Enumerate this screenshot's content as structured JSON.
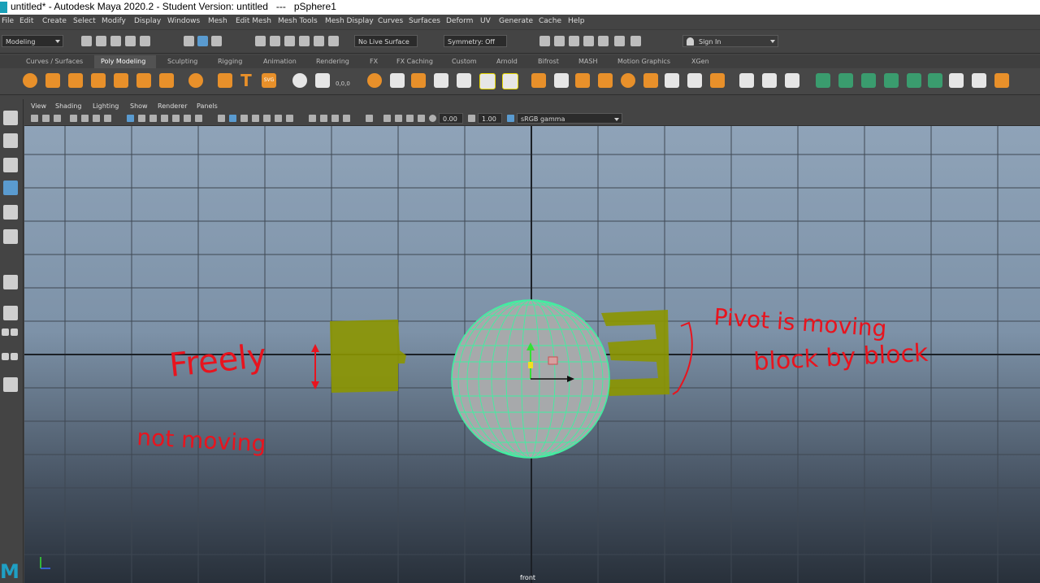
{
  "window": {
    "title": "untitled* - Autodesk Maya 2020.2 - Student Version: untitled   ---   pSphere1"
  },
  "menus": [
    "File",
    "Edit",
    "Create",
    "Select",
    "Modify",
    "Display",
    "Windows",
    "Mesh",
    "Edit Mesh",
    "Mesh Tools",
    "Mesh Display",
    "Curves",
    "Surfaces",
    "Deform",
    "UV",
    "Generate",
    "Cache",
    "Help"
  ],
  "status_line": {
    "mode": "Modeling",
    "live_surface": "No Live Surface",
    "symmetry": "Symmetry: Off",
    "sign_in": "Sign In"
  },
  "shelf_tabs": [
    "Curves / Surfaces",
    "Poly Modeling",
    "Sculpting",
    "Rigging",
    "Animation",
    "Rendering",
    "FX",
    "FX Caching",
    "Custom",
    "Arnold",
    "Bifrost",
    "MASH",
    "Motion Graphics",
    "XGen"
  ],
  "active_shelf_tab": "Poly Modeling",
  "shelf_text_icons": {
    "type": "T",
    "svg": "SVG",
    "coords": "0,0,0"
  },
  "panel": {
    "menus": [
      "View",
      "Shading",
      "Lighting",
      "Show",
      "Renderer",
      "Panels"
    ],
    "field_a": "0.00",
    "field_b": "1.00",
    "colorspace": "sRGB gamma",
    "camera": "front"
  },
  "annotations": {
    "freely": "Freely",
    "not_moving": "not moving",
    "pivot_line1": "Pivot is moving",
    "pivot_line2": "block by block"
  },
  "colors": {
    "viewport_top": "#8fa3b8",
    "viewport_bottom": "#28303a",
    "wireframe": "#3ff0a0",
    "annotation_red": "#e8141e",
    "highlight_olive": "#8c9600",
    "shelf_orange": "#e8902a"
  }
}
